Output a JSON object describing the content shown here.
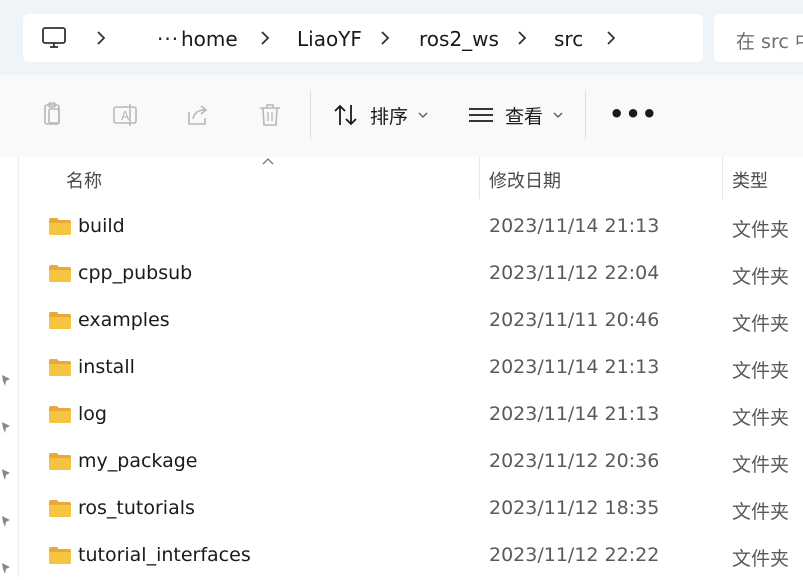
{
  "address_bar": {
    "overflow_label": "···",
    "crumbs": [
      "home",
      "LiaoYF",
      "ros2_ws",
      "src"
    ]
  },
  "search": {
    "placeholder": "在 src 中"
  },
  "toolbar": {
    "sort_label": "排序",
    "view_label": "查看",
    "more_label": "•••"
  },
  "columns": {
    "name": "名称",
    "date": "修改日期",
    "type": "类型"
  },
  "files": [
    {
      "name": "build",
      "date": "2023/11/14 21:13",
      "type": "文件夹"
    },
    {
      "name": "cpp_pubsub",
      "date": "2023/11/12 22:04",
      "type": "文件夹"
    },
    {
      "name": "examples",
      "date": "2023/11/11 20:46",
      "type": "文件夹"
    },
    {
      "name": "install",
      "date": "2023/11/14 21:13",
      "type": "文件夹"
    },
    {
      "name": "log",
      "date": "2023/11/14 21:13",
      "type": "文件夹"
    },
    {
      "name": "my_package",
      "date": "2023/11/12 20:36",
      "type": "文件夹"
    },
    {
      "name": "ros_tutorials",
      "date": "2023/11/12 18:35",
      "type": "文件夹"
    },
    {
      "name": "tutorial_interfaces",
      "date": "2023/11/12 22:22",
      "type": "文件夹"
    }
  ],
  "icons": {
    "computer": "computer-icon",
    "chevron": "chevron-right-icon",
    "copy": "copy-icon",
    "rename": "rename-icon",
    "share": "share-icon",
    "delete": "delete-icon",
    "sort": "sort-icon",
    "view": "view-icon",
    "folder": "folder-icon",
    "pin": "pin-icon"
  },
  "colors": {
    "folder": "#f5c542",
    "background": "#ffffff",
    "address_band": "#eff4f9"
  }
}
